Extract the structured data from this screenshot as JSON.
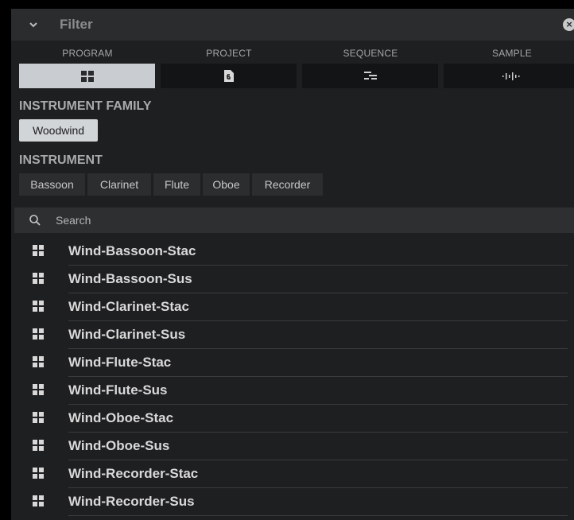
{
  "header": {
    "title": "Filter",
    "collapse_icon": "chevron-down-icon",
    "close_icon": "close-circle-icon"
  },
  "tabs": [
    {
      "label": "PROGRAM",
      "icon": "grid-icon",
      "active": true
    },
    {
      "label": "PROJECT",
      "icon": "document-icon",
      "active": false
    },
    {
      "label": "SEQUENCE",
      "icon": "sequence-icon",
      "active": false
    },
    {
      "label": "SAMPLE",
      "icon": "waveform-icon",
      "active": false
    }
  ],
  "instrument_family": {
    "title": "INSTRUMENT FAMILY",
    "items": [
      "Woodwind"
    ],
    "selected": "Woodwind"
  },
  "instrument": {
    "title": "INSTRUMENT",
    "items": [
      "Bassoon",
      "Clarinet",
      "Flute",
      "Oboe",
      "Recorder"
    ]
  },
  "search": {
    "placeholder": "Search",
    "value": ""
  },
  "results": [
    "Wind-Bassoon-Stac",
    "Wind-Bassoon-Sus",
    "Wind-Clarinet-Stac",
    "Wind-Clarinet-Sus",
    "Wind-Flute-Stac",
    "Wind-Flute-Sus",
    "Wind-Oboe-Stac",
    "Wind-Oboe-Sus",
    "Wind-Recorder-Stac",
    "Wind-Recorder-Sus"
  ],
  "colors": {
    "background": "#1e1f21",
    "header": "#2b2c2e",
    "active_tab": "#c9cdd1",
    "chip": "#2c2d2f",
    "chip_selected": "#d2d5d8"
  }
}
